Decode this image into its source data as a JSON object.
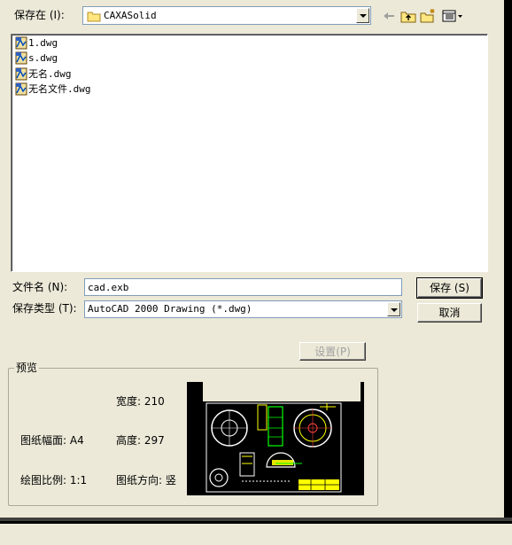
{
  "save_in": {
    "label": "保存在 (I):",
    "folder": "CAXASolid"
  },
  "toolbar": {
    "back": "back-arrow-icon",
    "up": "up-folder-icon",
    "new_folder": "new-folder-icon",
    "view": "view-menu-icon"
  },
  "files": [
    {
      "name": "1.dwg"
    },
    {
      "name": "s.dwg"
    },
    {
      "name": "无名.dwg"
    },
    {
      "name": "无名文件.dwg"
    }
  ],
  "filename": {
    "label": "文件名 (N):",
    "value": "cad.exb"
  },
  "filetype": {
    "label": "保存类型 (T):",
    "value": "AutoCAD 2000 Drawing (*.dwg)"
  },
  "buttons": {
    "save": "保存 (S)",
    "cancel": "取消",
    "settings": "设置(P)"
  },
  "preview": {
    "title": "预览",
    "width": "宽度: 210",
    "paper_size": "图纸幅面: A4",
    "height": "高度: 297",
    "scale": "绘图比例: 1:1",
    "orientation": "图纸方向: 竖"
  },
  "colors": {
    "dialog_bg": "#ece9d8",
    "preview_bg": "#000000",
    "cad_yellow": "#ffff00",
    "cad_green": "#00ff00"
  }
}
